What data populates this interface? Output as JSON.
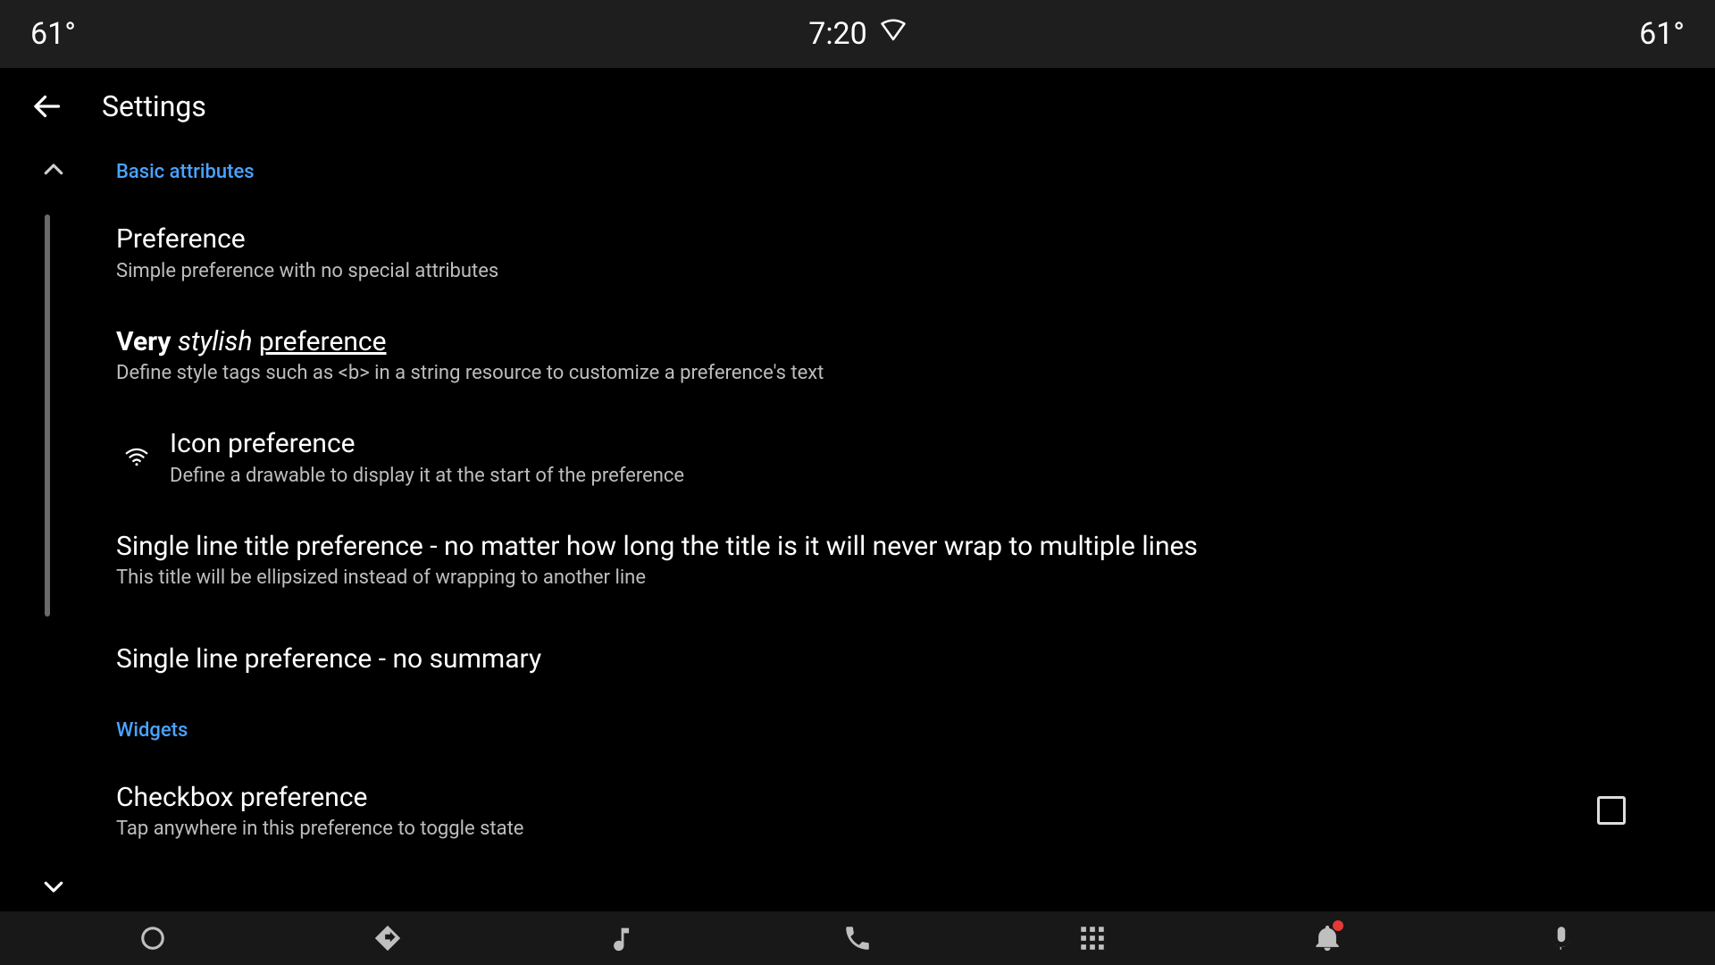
{
  "statusbar": {
    "left_temp": "61°",
    "time": "7:20",
    "right_temp": "61°"
  },
  "appbar": {
    "title": "Settings"
  },
  "categories": {
    "basic": "Basic attributes",
    "widgets": "Widgets"
  },
  "prefs": {
    "simple": {
      "title": "Preference",
      "summary": "Simple preference with no special attributes"
    },
    "stylish": {
      "title_very": "Very",
      "title_stylish": "stylish",
      "title_pref": "preference",
      "summary": "Define style tags such as <b> in a string resource to customize a preference's text"
    },
    "icon": {
      "title": "Icon preference",
      "summary": "Define a drawable to display it at the start of the preference"
    },
    "singleline": {
      "title": "Single line title preference - no matter how long the title is it will never wrap to multiple lines",
      "summary": "This title will be ellipsized instead of wrapping to another line"
    },
    "nosummary": {
      "title": "Single line preference - no summary"
    },
    "checkbox": {
      "title": "Checkbox preference",
      "summary": "Tap anywhere in this preference to toggle state",
      "checked": false
    }
  }
}
